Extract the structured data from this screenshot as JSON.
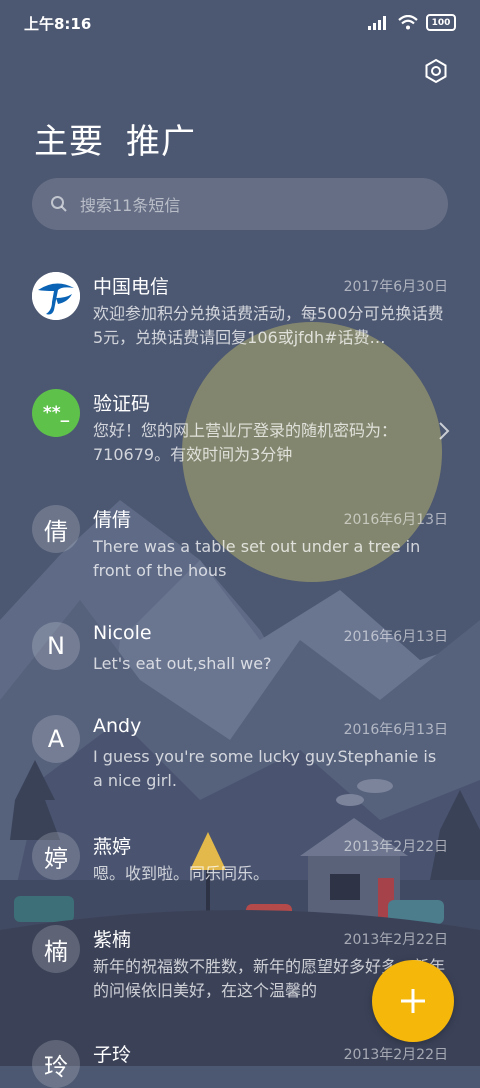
{
  "status_bar": {
    "time": "上午8:16",
    "battery": "100"
  },
  "tabs": [
    {
      "label": "主要"
    },
    {
      "label": "推广"
    }
  ],
  "search": {
    "placeholder": "搜索11条短信"
  },
  "messages": [
    {
      "name": "中国电信",
      "date": "2017年6月30日",
      "preview": "欢迎参加积分兑换话费活动，每500分可兑换话费5元，兑换话费请回复106或jfdh#话费…",
      "avatar": "telecom-logo"
    },
    {
      "name": "验证码",
      "date": "",
      "preview": "您好！您的网上营业厅登录的随机密码为：710679。有效时间为3分钟",
      "avatar": "**_"
    },
    {
      "name": "倩倩",
      "date": "2016年6月13日",
      "preview": "There was a table set out under a tree in front of the hous",
      "avatar": "倩"
    },
    {
      "name": "Nicole",
      "date": "2016年6月13日",
      "preview": "Let's eat out,shall we?",
      "avatar": "N"
    },
    {
      "name": "Andy",
      "date": "2016年6月13日",
      "preview": "I guess you're some lucky guy.Stephanie is a nice girl.",
      "avatar": "A"
    },
    {
      "name": "燕婷",
      "date": "2013年2月22日",
      "preview": "嗯。收到啦。同乐同乐。",
      "avatar": "婷"
    },
    {
      "name": "紫楠",
      "date": "2013年2月22日",
      "preview": "新年的祝福数不胜数，新年的愿望好多好多，新年的问候依旧美好，在这个温馨的",
      "avatar": "楠"
    },
    {
      "name": "子玲",
      "date": "2013年2月22日",
      "preview": "",
      "avatar": "玲"
    }
  ],
  "colors": {
    "accent": "#f6b70b",
    "telecom_blue": "#0a63b5",
    "verify_green": "#5ec24a"
  }
}
